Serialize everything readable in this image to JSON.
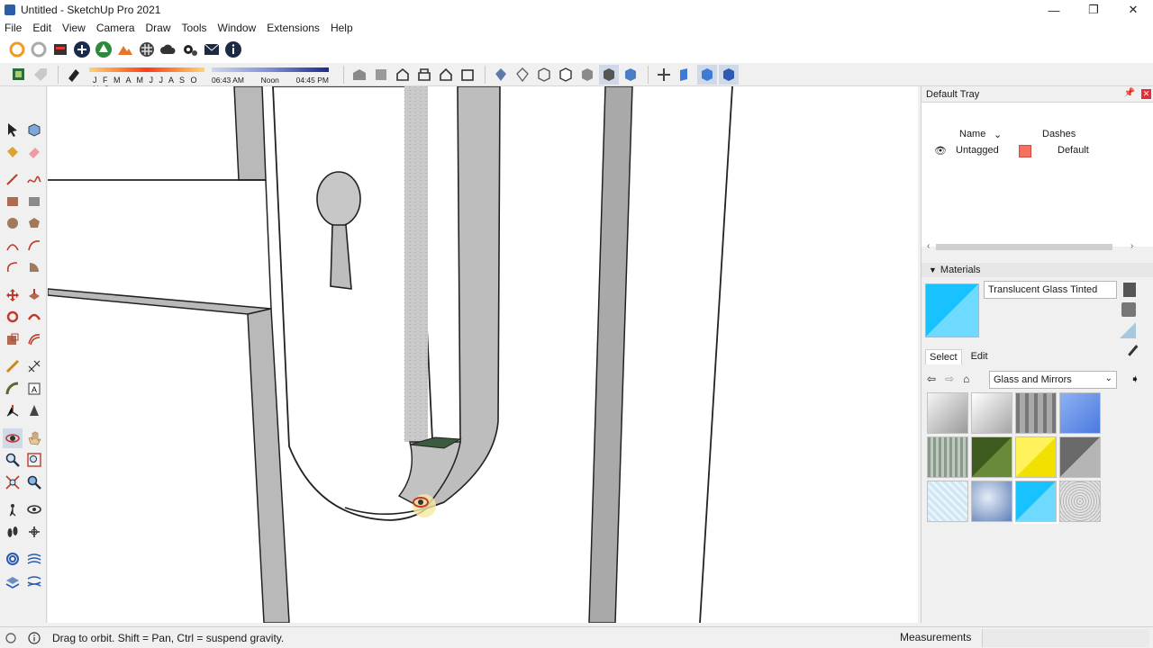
{
  "window": {
    "title": "Untitled - SketchUp Pro 2021",
    "controls": {
      "minimize": "—",
      "maximize": "❐",
      "close": "✕"
    }
  },
  "menu": [
    "File",
    "Edit",
    "View",
    "Camera",
    "Draw",
    "Tools",
    "Window",
    "Extensions",
    "Help"
  ],
  "shadows": {
    "months": "J F M A M J J A S O N D",
    "time_start": "06:43 AM",
    "time_mid": "Noon",
    "time_end": "04:45 PM"
  },
  "tray": {
    "title": "Default Tray",
    "tags": {
      "col_name": "Name",
      "col_dashes": "Dashes",
      "rows": [
        {
          "name": "Untagged",
          "dash": "Default",
          "color": "#f5705e"
        }
      ]
    },
    "materials": {
      "title": "Materials",
      "current_name": "Translucent Glass Tinted",
      "tab_select": "Select",
      "tab_edit": "Edit",
      "collection": "Glass and Mirrors"
    }
  },
  "status": {
    "hint": "Drag to orbit. Shift = Pan, Ctrl = suspend gravity.",
    "measurements_label": "Measurements",
    "measurements_value": ""
  }
}
